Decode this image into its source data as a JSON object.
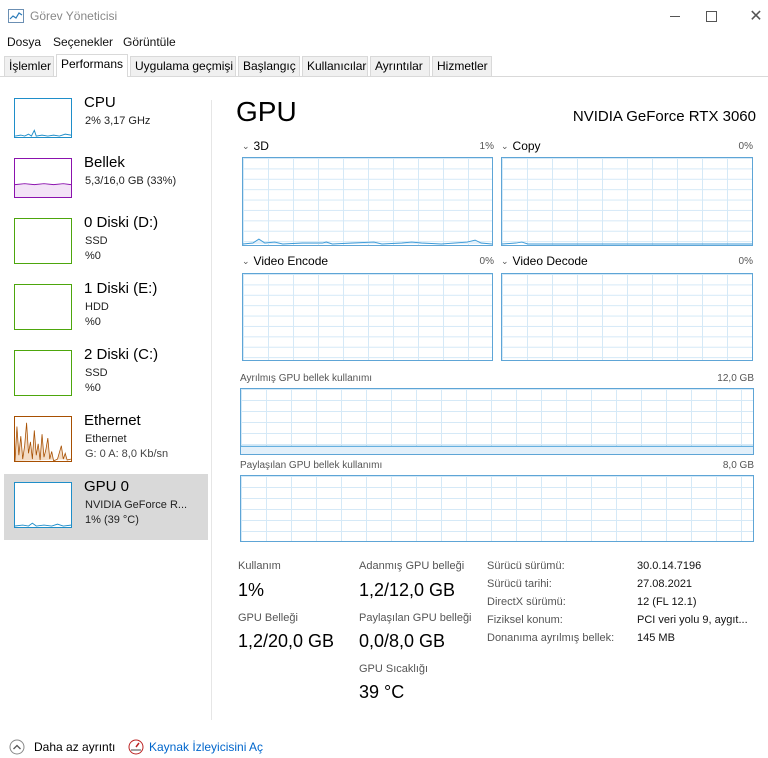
{
  "window": {
    "title": "Görev Yöneticisi",
    "buttons": [
      "minimize-icon",
      "maximize-icon",
      "close-icon"
    ]
  },
  "menu": [
    "Dosya",
    "Seçenekler",
    "Görüntüle"
  ],
  "tabs": [
    "İşlemler",
    "Performans",
    "Uygulama geçmişi",
    "Başlangıç",
    "Kullanıcılar",
    "Ayrıntılar",
    "Hizmetler"
  ],
  "active_tab": "Performans",
  "sidebar": {
    "items": [
      {
        "title": "CPU",
        "line1": "2% 3,17 GHz",
        "line2": "",
        "color": "#1f8ec9"
      },
      {
        "title": "Bellek",
        "line1": "5,3/16,0 GB (33%)",
        "line2": "",
        "color": "#8b12ae"
      },
      {
        "title": "0 Diski (D:)",
        "line1": "SSD",
        "line2": "%0",
        "color": "#4da60c"
      },
      {
        "title": "1 Diski (E:)",
        "line1": "HDD",
        "line2": "%0",
        "color": "#4da60c"
      },
      {
        "title": "2 Diski (C:)",
        "line1": "SSD",
        "line2": "%0",
        "color": "#4da60c"
      },
      {
        "title": "Ethernet",
        "line1": "Ethernet",
        "line2": "G: 0 A: 8,0 Kb/sn",
        "color": "#a74f01"
      },
      {
        "title": "GPU 0",
        "line1": "NVIDIA GeForce R...",
        "line2": "1% (39 °C)",
        "color": "#1f8ec9"
      }
    ],
    "selected": "GPU 0"
  },
  "main": {
    "title": "GPU",
    "model": "NVIDIA GeForce RTX 3060",
    "engines": [
      {
        "name": "3D",
        "percent": "1%"
      },
      {
        "name": "Copy",
        "percent": "0%"
      },
      {
        "name": "Video Encode",
        "percent": "0%"
      },
      {
        "name": "Video Decode",
        "percent": "0%"
      }
    ],
    "dedicated_mem": {
      "label": "Ayrılmış GPU bellek kullanımı",
      "max": "12,0 GB"
    },
    "shared_mem": {
      "label": "Paylaşılan GPU bellek kullanımı",
      "max": "8,0 GB"
    },
    "stats": {
      "usage_label": "Kullanım",
      "usage_value": "1%",
      "gpu_mem_label": "GPU Belleği",
      "gpu_mem_value": "1,2/20,0 GB",
      "dedicated_label": "Adanmış GPU belleği",
      "dedicated_value": "1,2/12,0 GB",
      "shared_label": "Paylaşılan GPU belleği",
      "shared_value": "0,0/8,0 GB",
      "temp_label": "GPU Sıcaklığı",
      "temp_value": "39 °C"
    },
    "properties": [
      {
        "label": "Sürücü sürümü:",
        "value": "30.0.14.7196"
      },
      {
        "label": "Sürücü tarihi:",
        "value": "27.08.2021"
      },
      {
        "label": "DirectX sürümü:",
        "value": "12 (FL 12.1)"
      },
      {
        "label": "Fiziksel konum:",
        "value": "PCI veri yolu 9, aygıt..."
      },
      {
        "label": "Donanıma ayrılmış bellek:",
        "value": "145 MB"
      }
    ]
  },
  "footer": {
    "less_details": "Daha az ayrıntı",
    "resource_monitor": "Kaynak İzleyicisini Aç"
  },
  "colors": {
    "accent": "#1f8ec9",
    "graph_border": "#5ea5d6",
    "grid": "#d5e9f7",
    "link": "#0066cc",
    "selected_bg": "#d9d9d9"
  }
}
